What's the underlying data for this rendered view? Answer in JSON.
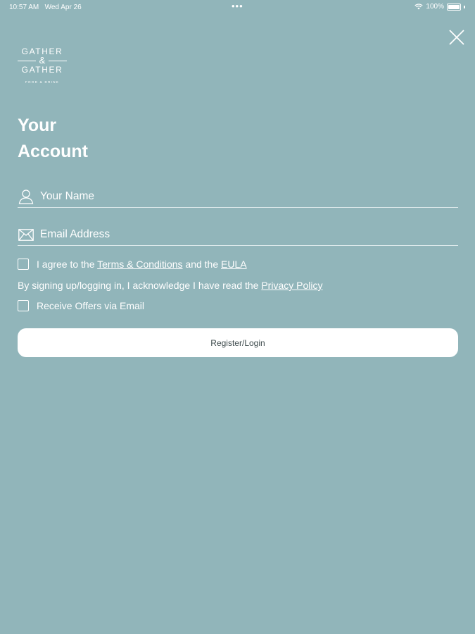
{
  "status_bar": {
    "time": "10:57 AM",
    "date": "Wed Apr 26",
    "battery": "100%"
  },
  "logo": {
    "line1": "GATHER",
    "amp": "&",
    "line2": "GATHER",
    "tagline": "FOOD & DRINK"
  },
  "heading": {
    "line1": "Your",
    "line2": "Account"
  },
  "form": {
    "name_placeholder": "Your Name",
    "email_placeholder": "Email Address",
    "terms_prefix": "I agree to the ",
    "terms_link": "Terms & Conditions",
    "terms_middle": " and the ",
    "eula_link": "EULA",
    "privacy_prefix": "By signing up/logging in, I acknowledge I have read the ",
    "privacy_link": "Privacy Policy",
    "offers_label": "Receive Offers via Email",
    "submit_label": "Register/Login"
  },
  "icons": {
    "close": "close-icon",
    "user": "user-icon",
    "email": "envelope-icon",
    "wifi": "wifi-icon",
    "battery": "battery-icon"
  }
}
